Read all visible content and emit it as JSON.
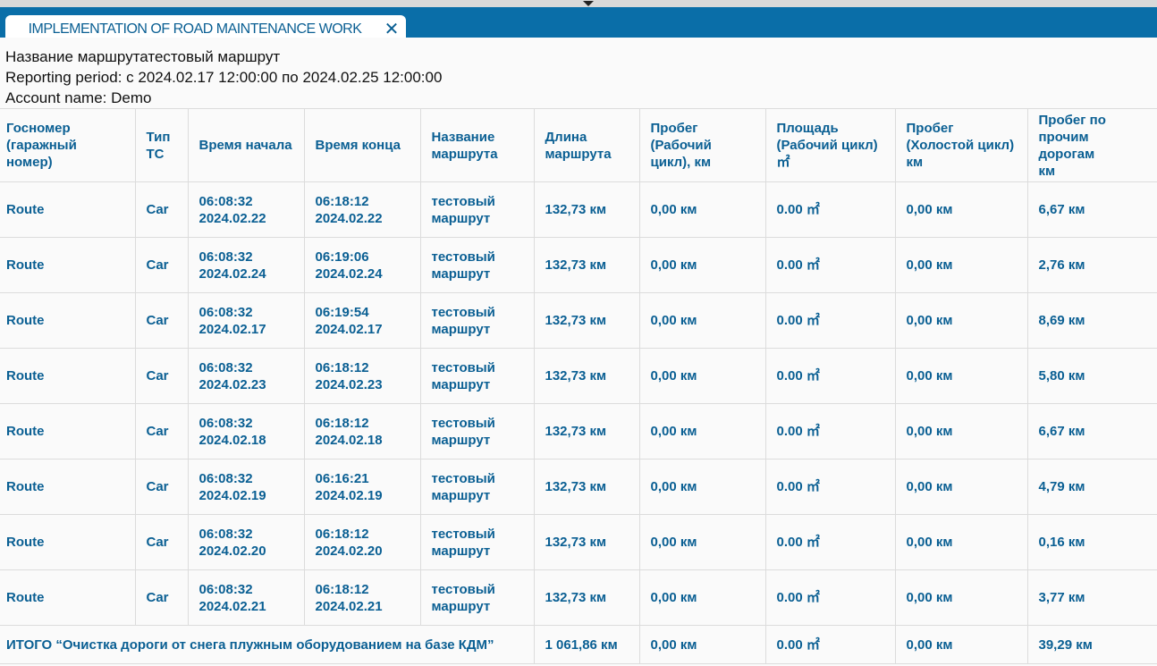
{
  "tab": {
    "title": "Implementation of road maintenance work",
    "close_glyph": "✕"
  },
  "info": {
    "route_name_line": "Название маршрутатестовый маршрут",
    "period_line": "Reporting period: с 2024.02.17 12:00:00 по 2024.02.25 12:00:00",
    "account_line": "Account name: Demo"
  },
  "table": {
    "headers": {
      "plate": [
        "Госномер",
        "(гаражный",
        "номер)"
      ],
      "type": [
        "Тип",
        "ТС"
      ],
      "start": [
        "Время начала"
      ],
      "end": [
        "Время конца"
      ],
      "route": [
        "Название",
        "маршрута"
      ],
      "length": [
        "Длина",
        "маршрута"
      ],
      "work_mileage": [
        "Пробег",
        "(Рабочий",
        "цикл), км"
      ],
      "area": [
        "Площадь",
        "(Рабочий цикл)",
        "㎡"
      ],
      "idle_mileage": [
        "Пробег",
        "(Холостой цикл)",
        "км"
      ],
      "other_mileage": [
        "Пробег по",
        "прочим дорогам",
        "км"
      ]
    },
    "rows": [
      {
        "plate": "Route",
        "type": "Car",
        "start_time": "06:08:32",
        "start_date": "2024.02.22",
        "end_time": "06:18:12",
        "end_date": "2024.02.22",
        "route_1": "тестовый",
        "route_2": "маршрут",
        "length": "132,73 км",
        "work": "0,00 км",
        "area": "0.00 ㎡",
        "idle": "0,00 км",
        "other": "6,67 км"
      },
      {
        "plate": "Route",
        "type": "Car",
        "start_time": "06:08:32",
        "start_date": "2024.02.24",
        "end_time": "06:19:06",
        "end_date": "2024.02.24",
        "route_1": "тестовый",
        "route_2": "маршрут",
        "length": "132,73 км",
        "work": "0,00 км",
        "area": "0.00 ㎡",
        "idle": "0,00 км",
        "other": "2,76 км"
      },
      {
        "plate": "Route",
        "type": "Car",
        "start_time": "06:08:32",
        "start_date": "2024.02.17",
        "end_time": "06:19:54",
        "end_date": "2024.02.17",
        "route_1": "тестовый",
        "route_2": "маршрут",
        "length": "132,73 км",
        "work": "0,00 км",
        "area": "0.00 ㎡",
        "idle": "0,00 км",
        "other": "8,69 км"
      },
      {
        "plate": "Route",
        "type": "Car",
        "start_time": "06:08:32",
        "start_date": "2024.02.23",
        "end_time": "06:18:12",
        "end_date": "2024.02.23",
        "route_1": "тестовый",
        "route_2": "маршрут",
        "length": "132,73 км",
        "work": "0,00 км",
        "area": "0.00 ㎡",
        "idle": "0,00 км",
        "other": "5,80 км"
      },
      {
        "plate": "Route",
        "type": "Car",
        "start_time": "06:08:32",
        "start_date": "2024.02.18",
        "end_time": "06:18:12",
        "end_date": "2024.02.18",
        "route_1": "тестовый",
        "route_2": "маршрут",
        "length": "132,73 км",
        "work": "0,00 км",
        "area": "0.00 ㎡",
        "idle": "0,00 км",
        "other": "6,67 км"
      },
      {
        "plate": "Route",
        "type": "Car",
        "start_time": "06:08:32",
        "start_date": "2024.02.19",
        "end_time": "06:16:21",
        "end_date": "2024.02.19",
        "route_1": "тестовый",
        "route_2": "маршрут",
        "length": "132,73 км",
        "work": "0,00 км",
        "area": "0.00 ㎡",
        "idle": "0,00 км",
        "other": "4,79 км"
      },
      {
        "plate": "Route",
        "type": "Car",
        "start_time": "06:08:32",
        "start_date": "2024.02.20",
        "end_time": "06:18:12",
        "end_date": "2024.02.20",
        "route_1": "тестовый",
        "route_2": "маршрут",
        "length": "132,73 км",
        "work": "0,00 км",
        "area": "0.00 ㎡",
        "idle": "0,00 км",
        "other": "0,16 км"
      },
      {
        "plate": "Route",
        "type": "Car",
        "start_time": "06:08:32",
        "start_date": "2024.02.21",
        "end_time": "06:18:12",
        "end_date": "2024.02.21",
        "route_1": "тестовый",
        "route_2": "маршрут",
        "length": "132,73 км",
        "work": "0,00 км",
        "area": "0.00 ㎡",
        "idle": "0,00 км",
        "other": "3,77 км"
      }
    ],
    "total": {
      "label": "ИТОГО “Очистка дороги от снега плужным оборудованием на базе КДМ”",
      "length": "1 061,86 км",
      "work": "0,00 км",
      "area": "0.00 ㎡",
      "idle": "0,00 км",
      "other": "39,29 км"
    }
  },
  "colors": {
    "accent": "#0a6ea8",
    "text_accent": "#0a5f93"
  }
}
